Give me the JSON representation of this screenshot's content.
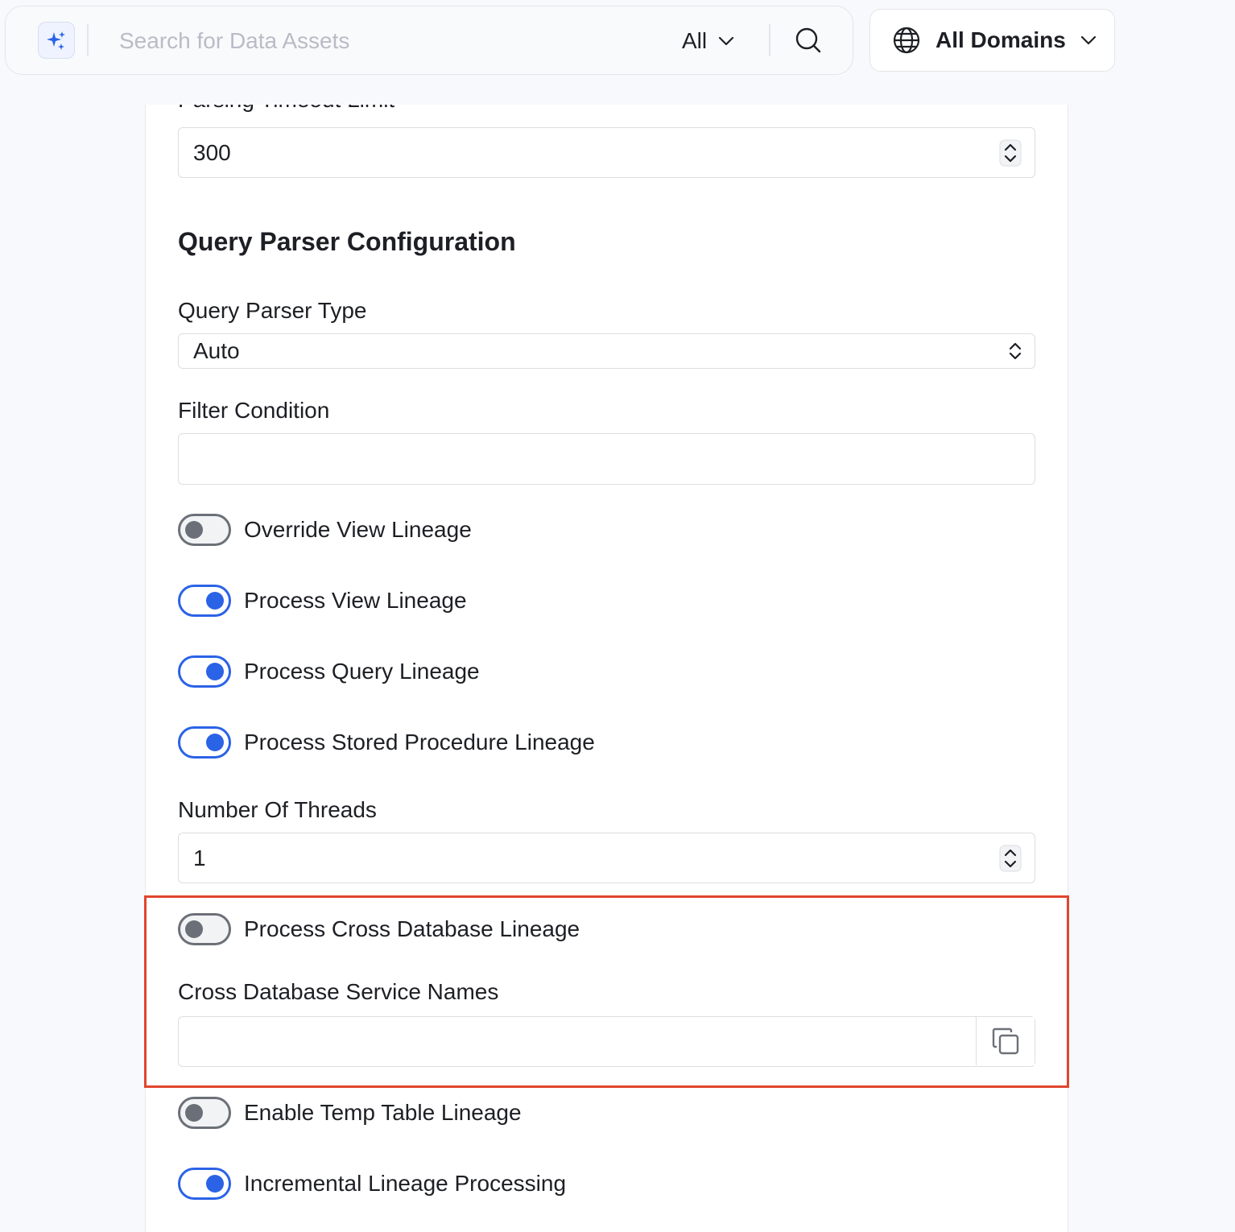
{
  "topbar": {
    "search_placeholder": "Search for Data Assets",
    "scope_label": "All",
    "domains_label": "All Domains",
    "accent_color": "#2b63e6"
  },
  "form": {
    "parsing_timeout_label": "Parsing Timeout Limit",
    "parsing_timeout_value": "300",
    "section_title": "Query Parser Configuration",
    "query_parser_type_label": "Query Parser Type",
    "query_parser_type_value": "Auto",
    "filter_condition_label": "Filter Condition",
    "filter_condition_value": "",
    "toggles": [
      {
        "label": "Override View Lineage",
        "on": false
      },
      {
        "label": "Process View Lineage",
        "on": true
      },
      {
        "label": "Process Query Lineage",
        "on": true
      },
      {
        "label": "Process Stored Procedure Lineage",
        "on": true
      }
    ],
    "threads_label": "Number Of Threads",
    "threads_value": "1",
    "cross_db_toggle": {
      "label": "Process Cross Database Lineage",
      "on": false
    },
    "cross_db_service_names_label": "Cross Database Service Names",
    "cross_db_service_names_value": "",
    "temp_table_toggle": {
      "label": "Enable Temp Table Lineage",
      "on": false
    },
    "incremental_toggle": {
      "label": "Incremental Lineage Processing",
      "on": true
    }
  },
  "highlight_color": "#e0452e"
}
